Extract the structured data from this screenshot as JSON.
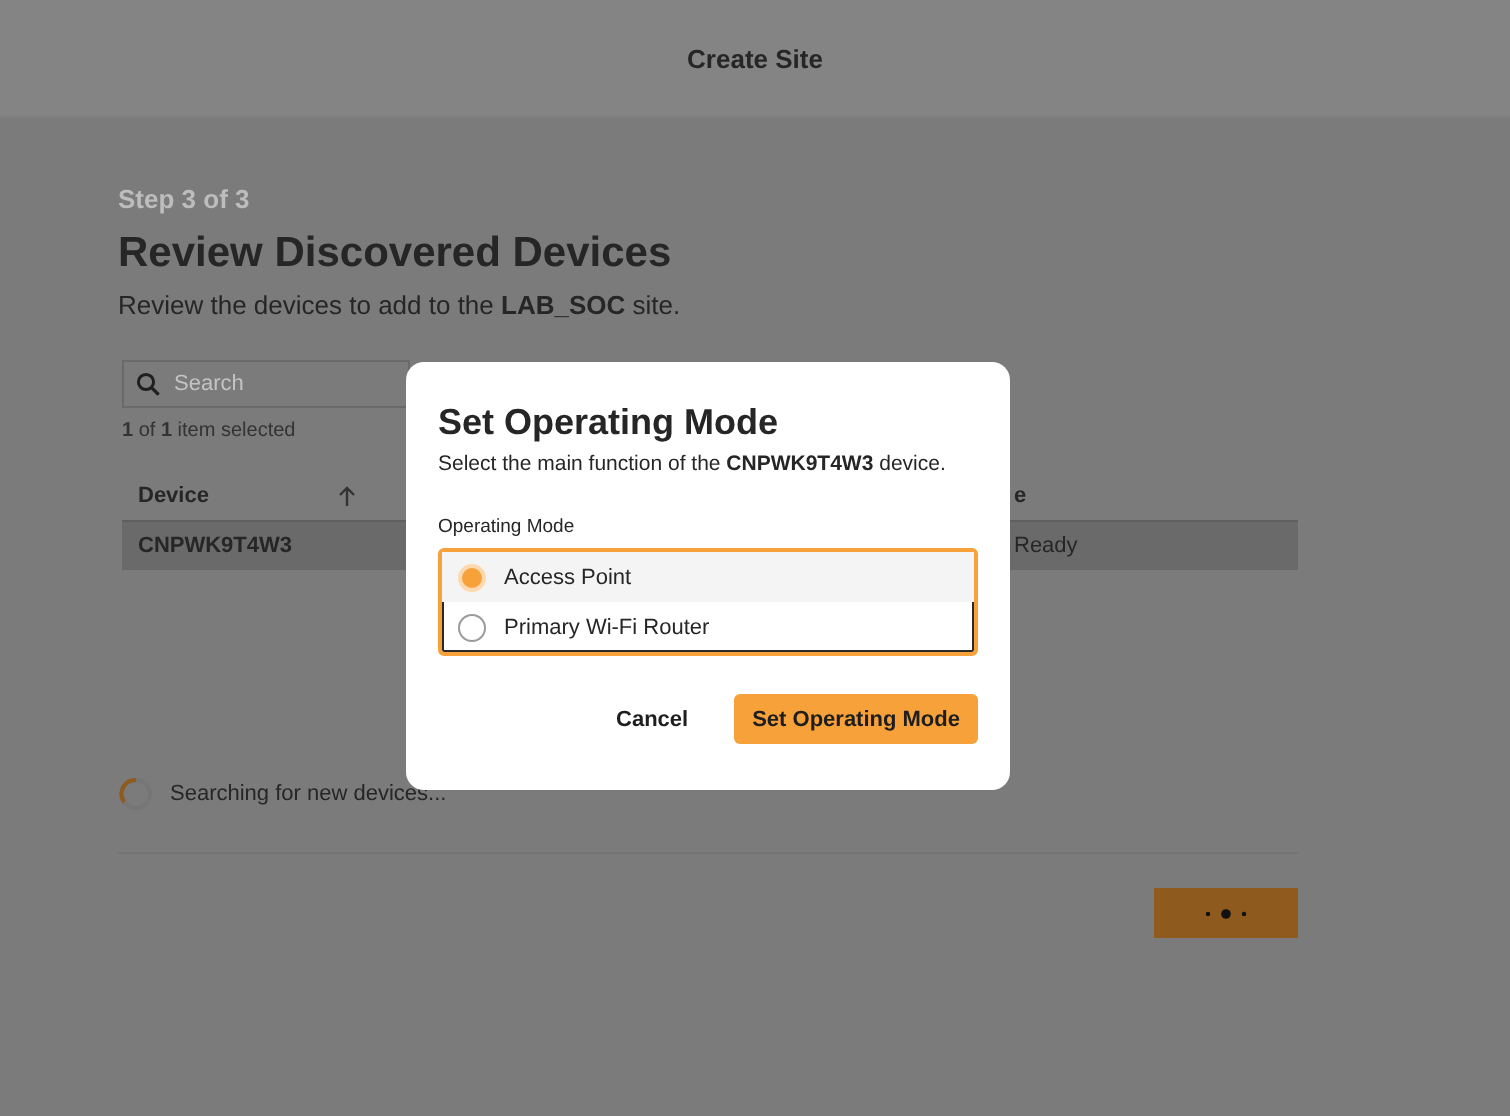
{
  "header": {
    "title": "Create Site"
  },
  "step": "Step 3 of 3",
  "heading": "Review Discovered Devices",
  "subtitle": "Review the devices to add to the **LAB_SOC** site.",
  "search": {
    "placeholder": "Search"
  },
  "selection_count": "**1** of **1** item selected",
  "table": {
    "columns": [
      "Device",
      "e"
    ],
    "rows": [
      {
        "cells": [
          "CNPWK9T4W3",
          "Ready"
        ],
        "selected": true
      }
    ]
  },
  "status": "Searching for new devices...",
  "footer_button": {
    "loading": true
  },
  "dialog": {
    "title": "Set Operating Mode",
    "description": "Select the main function of the **CNPWK9T4W3** device.",
    "field_label": "Operating Mode",
    "options": [
      {
        "label": "Access Point",
        "selected": true
      },
      {
        "label": "Primary Wi-Fi Router",
        "selected": false
      }
    ],
    "buttons": [
      {
        "label": "Cancel",
        "kind": "secondary"
      },
      {
        "label": "Set Operating Mode",
        "kind": "primary"
      }
    ]
  }
}
